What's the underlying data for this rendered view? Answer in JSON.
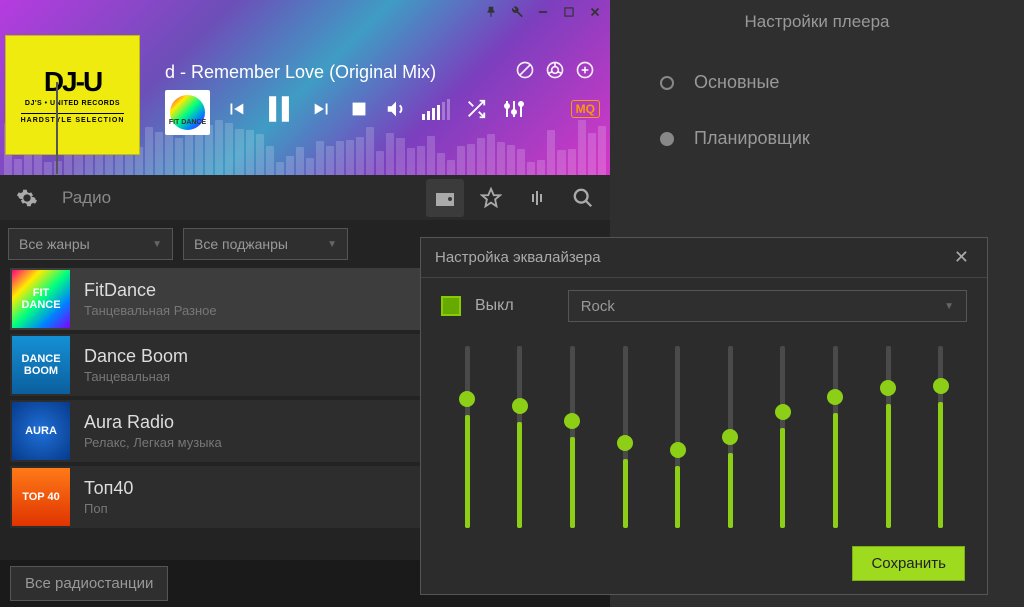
{
  "player": {
    "track_title": "d - Remember Love (Original Mix)",
    "mq": "MQ",
    "album_logo": "DJ-U",
    "album_sub": "DJ'S • UNITED RECORDS",
    "album_sel": "HARDSTYLE SELECTION",
    "mini_label": "FIT DANCE"
  },
  "toolbar": {
    "label": "Радио"
  },
  "filters": {
    "genres": "Все жанры",
    "subgenres": "Все поджанры"
  },
  "stations": [
    {
      "name": "FitDance",
      "genre": "Танцевальная Разное",
      "thumb_label": "FIT DANCE",
      "thumb_bg": "linear-gradient(135deg,#ff0080,#ffeb00,#00ff80,#0080ff,#8000ff)",
      "active": true
    },
    {
      "name": "Dance Boom",
      "genre": "Танцевальная",
      "thumb_label": "DANCE BOOM",
      "thumb_bg": "linear-gradient(180deg,#1590d4,#0b5f9e)"
    },
    {
      "name": "Aura Radio",
      "genre": "Релакс, Легкая музыка",
      "thumb_label": "AURA",
      "thumb_bg": "radial-gradient(circle,#2070d8,#063a8a)"
    },
    {
      "name": "Топ40",
      "genre": "Поп",
      "thumb_label": "TOP 40",
      "thumb_bg": "linear-gradient(180deg,#ff7a18,#e03400)"
    }
  ],
  "bottom_tab": "Все радиостанции",
  "settings": {
    "title": "Настройки плеера",
    "items": [
      "Основные",
      "Планировщик"
    ],
    "selected": 1
  },
  "equalizer": {
    "title": "Настройка эквалайзера",
    "off_label": "Выкл",
    "preset": "Rock",
    "save": "Сохранить",
    "bands_pct": [
      62,
      58,
      50,
      38,
      34,
      41,
      55,
      63,
      68,
      69
    ]
  }
}
